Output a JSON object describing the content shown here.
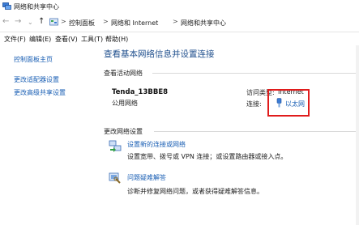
{
  "window": {
    "title": "网络和共享中心"
  },
  "addressbar": {
    "crumbs": [
      "控制面板",
      "网络和 Internet",
      "网络和共享中心"
    ],
    "separator": ">"
  },
  "menu": {
    "items": [
      "文件(F)",
      "编辑(E)",
      "查看(V)",
      "工具(T)",
      "帮助(H)"
    ]
  },
  "sidebar": {
    "items": [
      {
        "label": "控制面板主页"
      },
      {
        "label": "更改适配器设置"
      },
      {
        "label": "更改高级共享设置"
      }
    ]
  },
  "main": {
    "title": "查看基本网络信息并设置连接",
    "active_networks_heading": "查看活动网络",
    "network": {
      "name": "Tenda_13BBE8",
      "type": "公用网络",
      "access_type_label": "访问类型:",
      "access_type_value": "Internet",
      "connections_label": "连接:",
      "connections_value": "以太网"
    },
    "change_settings_heading": "更改网络设置",
    "tasks": [
      {
        "title": "设置新的连接或网络",
        "description": "设置宽带、拨号或 VPN 连接；或设置路由器或接入点。",
        "icon": "network-setup-icon"
      },
      {
        "title": "问题疑难解答",
        "description": "诊断并修复网络问题，或者获得疑难解答信息。",
        "icon": "troubleshoot-icon"
      }
    ]
  },
  "colors": {
    "link": "#1a5fb4",
    "title": "#1e4e8c",
    "highlight_box": "#e01c1c"
  }
}
